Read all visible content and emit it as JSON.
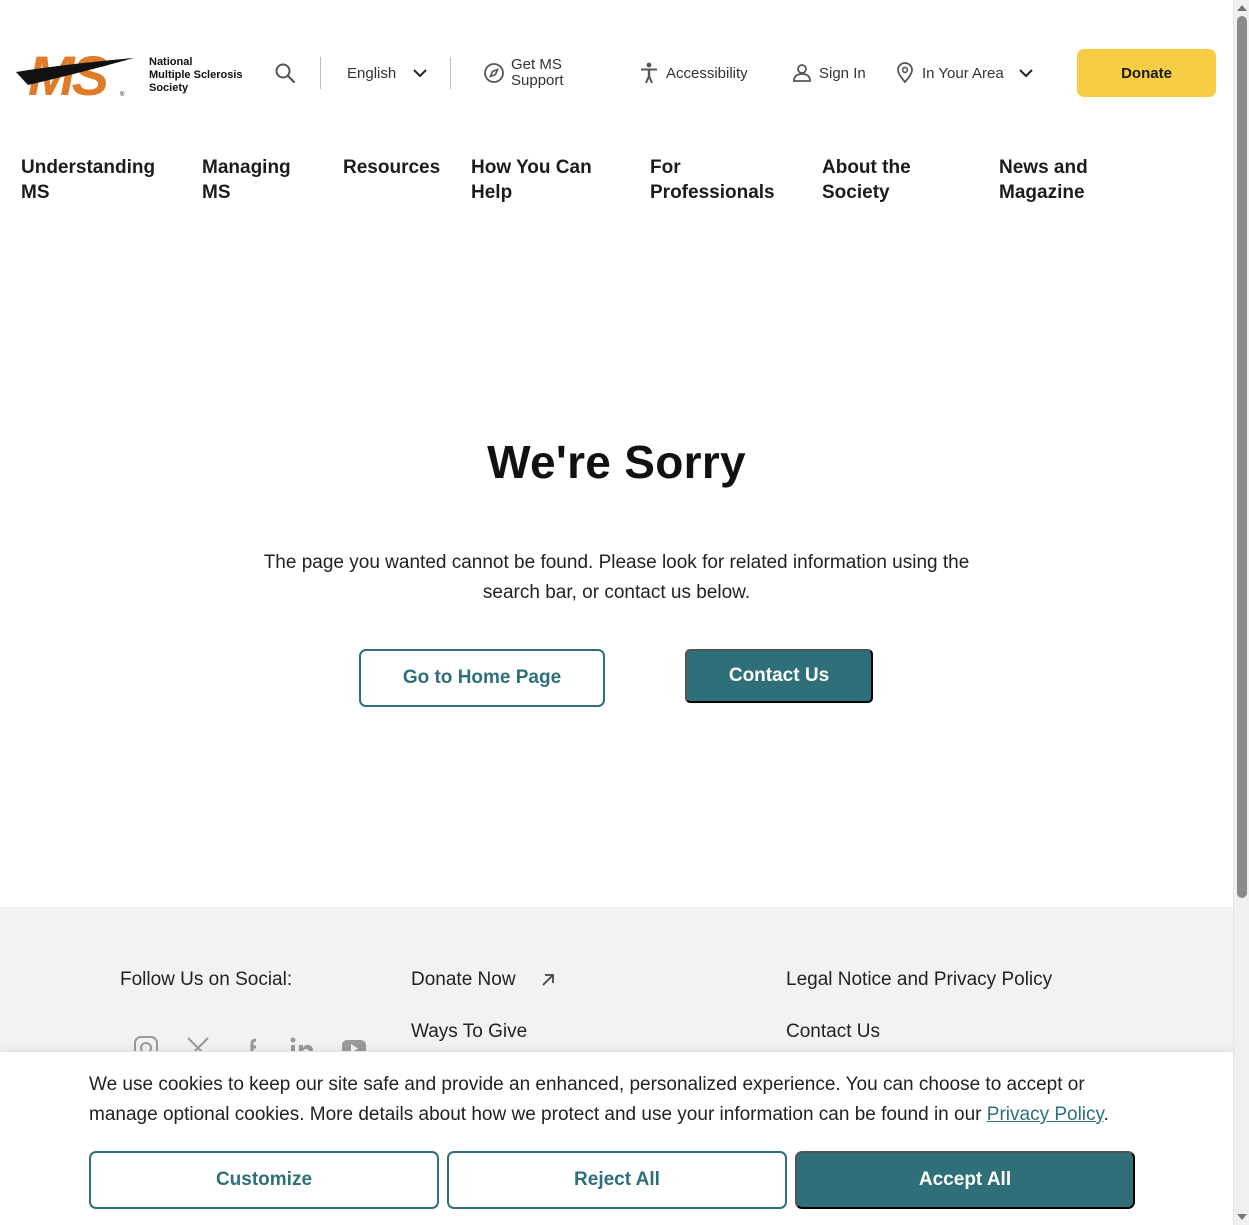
{
  "header": {
    "logo_lines": [
      "National",
      "Multiple Sclerosis",
      "Society"
    ],
    "language": "English",
    "support_line1": "Get MS",
    "support_line2": "Support",
    "accessibility": "Accessibility",
    "sign_in": "Sign In",
    "area": "In Your Area",
    "donate": "Donate"
  },
  "nav": {
    "items": [
      {
        "line1": "Understanding",
        "line2": "MS"
      },
      {
        "line1": "Managing",
        "line2": "MS"
      },
      {
        "line1": "Resources",
        "line2": ""
      },
      {
        "line1": "How You Can",
        "line2": "Help"
      },
      {
        "line1": "For",
        "line2": "Professionals"
      },
      {
        "line1": "About the",
        "line2": "Society"
      },
      {
        "line1": "News and",
        "line2": "Magazine"
      }
    ]
  },
  "main": {
    "title": "We're Sorry",
    "message": "The page you wanted cannot be found. Please look for related information using the search bar, or contact us below.",
    "home_button": "Go to Home Page",
    "contact_button": "Contact Us"
  },
  "footer": {
    "follow": "Follow Us on Social:",
    "donate_now": "Donate Now",
    "ways_to_give": "Ways To Give",
    "legal": "Legal Notice and Privacy Policy",
    "contact": "Contact Us"
  },
  "cookie": {
    "message": "We use cookies to keep our site safe and provide an enhanced, personalized experience. You can choose to accept or manage optional cookies. More details about how we protect and use your information can be found in our",
    "link": "Privacy Policy",
    "period": ".",
    "customize": "Customize",
    "reject": "Reject All",
    "accept": "Accept All"
  },
  "colors": {
    "brand_orange": "#e07b27",
    "teal": "#2e6f7a",
    "donate_yellow": "#f6cd45"
  }
}
